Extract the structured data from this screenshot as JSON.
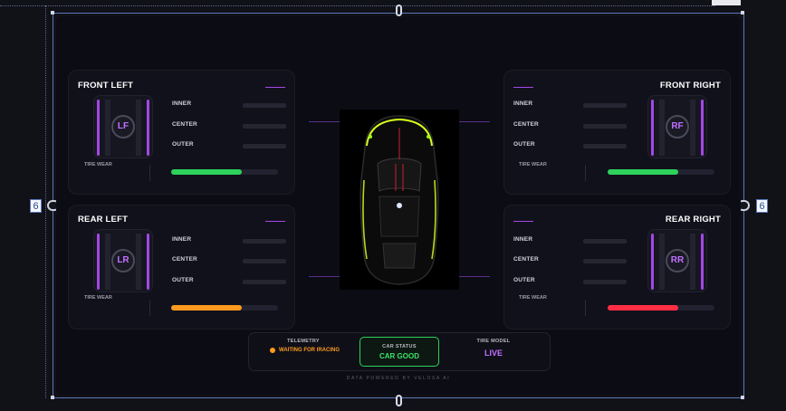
{
  "editor": {
    "left_guide_value": "6",
    "right_guide_value": "6"
  },
  "tires": {
    "fl": {
      "title": "FRONT LEFT",
      "code": "LF",
      "wear_label": "TIRE WEAR",
      "inner": "INNER",
      "center": "CENTER",
      "outer": "OUTER",
      "wear": 0.66,
      "wear_color": "#2dd25a"
    },
    "fr": {
      "title": "FRONT RIGHT",
      "code": "RF",
      "wear_label": "TIRE WEAR",
      "inner": "INNER",
      "center": "CENTER",
      "outer": "OUTER",
      "wear": 0.66,
      "wear_color": "#2dd25a"
    },
    "rl": {
      "title": "REAR LEFT",
      "code": "LR",
      "wear_label": "TIRE WEAR",
      "inner": "INNER",
      "center": "CENTER",
      "outer": "OUTER",
      "wear": 0.66,
      "wear_color": "#ff9a1f"
    },
    "rr": {
      "title": "REAR RIGHT",
      "code": "RR",
      "wear_label": "TIRE WEAR",
      "inner": "INNER",
      "center": "CENTER",
      "outer": "OUTER",
      "wear": 0.66,
      "wear_color": "#ff2e44"
    }
  },
  "status": {
    "telemetry_label": "TELEMETRY",
    "telemetry_value": "WAITING FOR IRACING",
    "car_status_label": "CAR STATUS",
    "car_status_value": "CAR GOOD",
    "tire_model_label": "TIRE MODEL",
    "tire_model_value": "LIVE"
  },
  "footer": {
    "text": "DATA POWERED BY VELOSA AI"
  },
  "colors": {
    "accent": "#a248e6",
    "good": "#2dd25a",
    "warn": "#ff9a1f",
    "bad": "#ff2e44",
    "telemetry_dot": "#ff9a1f",
    "car_accent": "#d9ff1e"
  }
}
